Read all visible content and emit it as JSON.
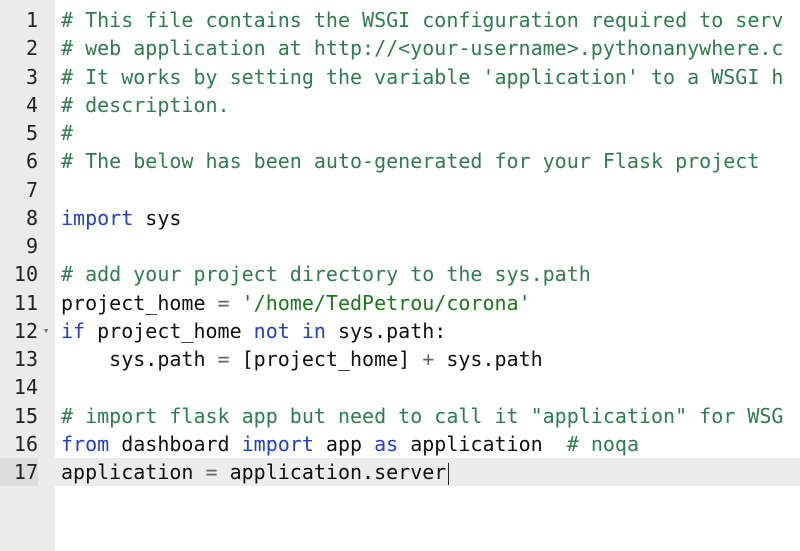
{
  "editor": {
    "active_line": "17",
    "lines": [
      {
        "num": "1",
        "tokens": [
          {
            "t": "c",
            "v": "# This file contains the WSGI configuration required to serv"
          }
        ]
      },
      {
        "num": "2",
        "tokens": [
          {
            "t": "c",
            "v": "# web application at http://<your-username>.pythonanywhere.c"
          }
        ]
      },
      {
        "num": "3",
        "tokens": [
          {
            "t": "c",
            "v": "# It works by setting the variable 'application' to a WSGI h"
          }
        ]
      },
      {
        "num": "4",
        "tokens": [
          {
            "t": "c",
            "v": "# description."
          }
        ]
      },
      {
        "num": "5",
        "tokens": [
          {
            "t": "c",
            "v": "#"
          }
        ]
      },
      {
        "num": "6",
        "tokens": [
          {
            "t": "c",
            "v": "# The below has been auto-generated for your Flask project"
          }
        ]
      },
      {
        "num": "7",
        "tokens": []
      },
      {
        "num": "8",
        "tokens": [
          {
            "t": "k",
            "v": "import"
          },
          {
            "t": "p",
            "v": " sys"
          }
        ]
      },
      {
        "num": "9",
        "tokens": []
      },
      {
        "num": "10",
        "tokens": [
          {
            "t": "c",
            "v": "# add your project directory to the sys.path"
          }
        ]
      },
      {
        "num": "11",
        "tokens": [
          {
            "t": "p",
            "v": "project_home "
          },
          {
            "t": "o",
            "v": "="
          },
          {
            "t": "p",
            "v": " "
          },
          {
            "t": "s",
            "v": "'/home/TedPetrou/corona'"
          }
        ]
      },
      {
        "num": "12",
        "fold": true,
        "tokens": [
          {
            "t": "k",
            "v": "if"
          },
          {
            "t": "p",
            "v": " project_home "
          },
          {
            "t": "k",
            "v": "not"
          },
          {
            "t": "p",
            "v": " "
          },
          {
            "t": "k",
            "v": "in"
          },
          {
            "t": "p",
            "v": " sys.path:"
          }
        ]
      },
      {
        "num": "13",
        "tokens": [
          {
            "t": "p",
            "v": "    sys.path "
          },
          {
            "t": "o",
            "v": "="
          },
          {
            "t": "p",
            "v": " [project_home] "
          },
          {
            "t": "o",
            "v": "+"
          },
          {
            "t": "p",
            "v": " sys.path"
          }
        ]
      },
      {
        "num": "14",
        "tokens": []
      },
      {
        "num": "15",
        "tokens": [
          {
            "t": "c",
            "v": "# import flask app but need to call it \"application\" for WSG"
          }
        ]
      },
      {
        "num": "16",
        "tokens": [
          {
            "t": "k",
            "v": "from"
          },
          {
            "t": "p",
            "v": " dashboard "
          },
          {
            "t": "k",
            "v": "import"
          },
          {
            "t": "p",
            "v": " app "
          },
          {
            "t": "k",
            "v": "as"
          },
          {
            "t": "p",
            "v": " application  "
          },
          {
            "t": "c",
            "v": "# noqa"
          }
        ]
      },
      {
        "num": "17",
        "tokens": [
          {
            "t": "p",
            "v": "application "
          },
          {
            "t": "o",
            "v": "="
          },
          {
            "t": "p",
            "v": " application.server"
          }
        ]
      }
    ]
  },
  "icons": {
    "fold": "fold-arrow-icon"
  }
}
